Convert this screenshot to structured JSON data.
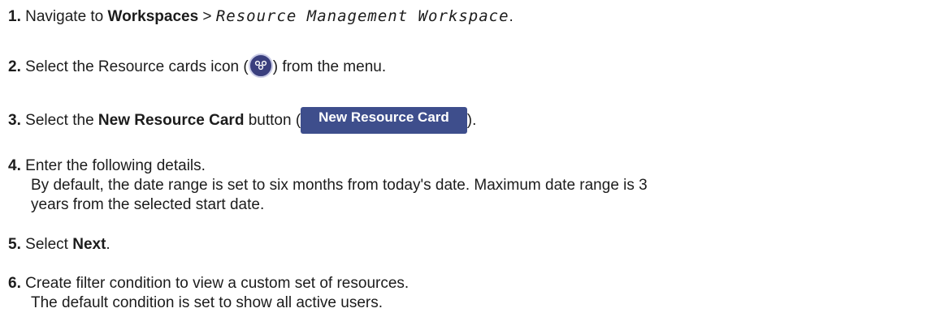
{
  "steps": [
    {
      "num": "1.",
      "prefix": "Navigate to ",
      "bold": "Workspaces",
      "sep": " > ",
      "mono": "Resource Management Workspace",
      "suffix": "."
    },
    {
      "num": "2.",
      "prefix": "Select the Resource cards icon (",
      "icon": "resource-cards-icon",
      "suffix": ") from the menu."
    },
    {
      "num": "3.",
      "prefix": "Select the ",
      "bold": "New Resource Card",
      "mid": " button (",
      "button_label": "New Resource Card",
      "suffix": ")."
    },
    {
      "num": "4.",
      "line1": "Enter the following details.",
      "line2": "By default, the date range is set to six months from today's date. Maximum date range is 3",
      "line3": "years from the selected start date."
    },
    {
      "num": "5.",
      "prefix": "Select ",
      "bold": "Next",
      "suffix": "."
    },
    {
      "num": "6.",
      "line1": "Create filter condition to view a custom set of resources.",
      "line2": "The default condition is set to show all active users."
    }
  ],
  "colors": {
    "icon_bg": "#3a3f7e",
    "button_bg": "#3e4e8c"
  }
}
